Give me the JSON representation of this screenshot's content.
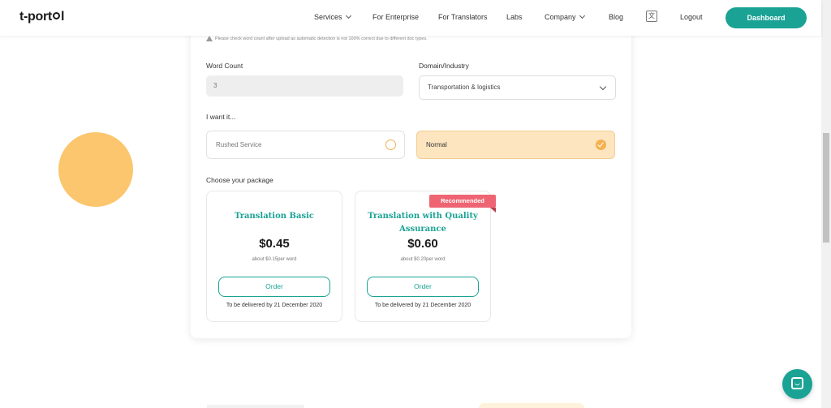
{
  "header": {
    "logo": "t-portal",
    "nav": [
      {
        "label": "Services",
        "has_dropdown": true
      },
      {
        "label": "For Enterprise",
        "has_dropdown": false
      },
      {
        "label": "For Translators",
        "has_dropdown": false
      },
      {
        "label": "Labs",
        "has_dropdown": false
      },
      {
        "label": "Company",
        "has_dropdown": true
      },
      {
        "label": "Blog",
        "has_dropdown": false
      }
    ],
    "logout": "Logout",
    "dashboard": "Dashboard"
  },
  "form": {
    "warning": "Please check word count after upload as automatic detection is not 100% correct due to different doc types.",
    "word_count_label": "Word Count",
    "word_count_value": "3",
    "domain_label": "Domain/Industry",
    "domain_value": "Transportation & logistics",
    "want_label": "I want it...",
    "options": [
      {
        "label": "Rushed Service",
        "selected": false
      },
      {
        "label": "Normal",
        "selected": true
      }
    ],
    "package_label": "Choose your package"
  },
  "packages": [
    {
      "title": "Translation Basic",
      "price": "$0.45",
      "per_word": "about $0.15per word",
      "order": "Order",
      "delivery": "To be delivered by 21 December 2020"
    },
    {
      "title": "Translation with Quality Assurance",
      "price": "$0.60",
      "per_word": "about $0.20per word",
      "order": "Order",
      "delivery": "To be delivered by 21 December 2020",
      "badge": "Recommended"
    }
  ],
  "colors": {
    "accent": "#1aa395",
    "selected_bg": "#fde5c0",
    "badge": "#ef6473",
    "deco_circle": "#fbc66e"
  }
}
